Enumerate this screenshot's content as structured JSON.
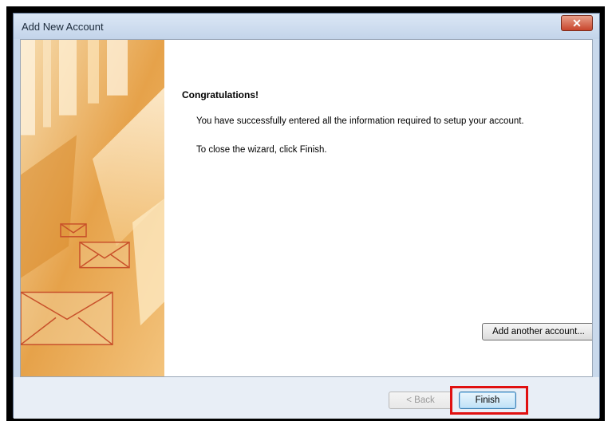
{
  "window": {
    "title": "Add New Account",
    "close_glyph": "✕"
  },
  "main": {
    "heading": "Congratulations!",
    "message_success": "You have successfully entered all the information required to setup your account.",
    "message_close": "To close the wizard, click Finish.",
    "add_account_label": "Add another account..."
  },
  "footer": {
    "back_label": "< Back",
    "finish_label": "Finish"
  },
  "annotation": {
    "highlight_color": "#e01010",
    "highlighted_control": "finish-button"
  },
  "colors": {
    "side_art_orange": "#e29a3a",
    "side_art_light": "#f6d29a",
    "envelope_line": "#c8502a"
  }
}
